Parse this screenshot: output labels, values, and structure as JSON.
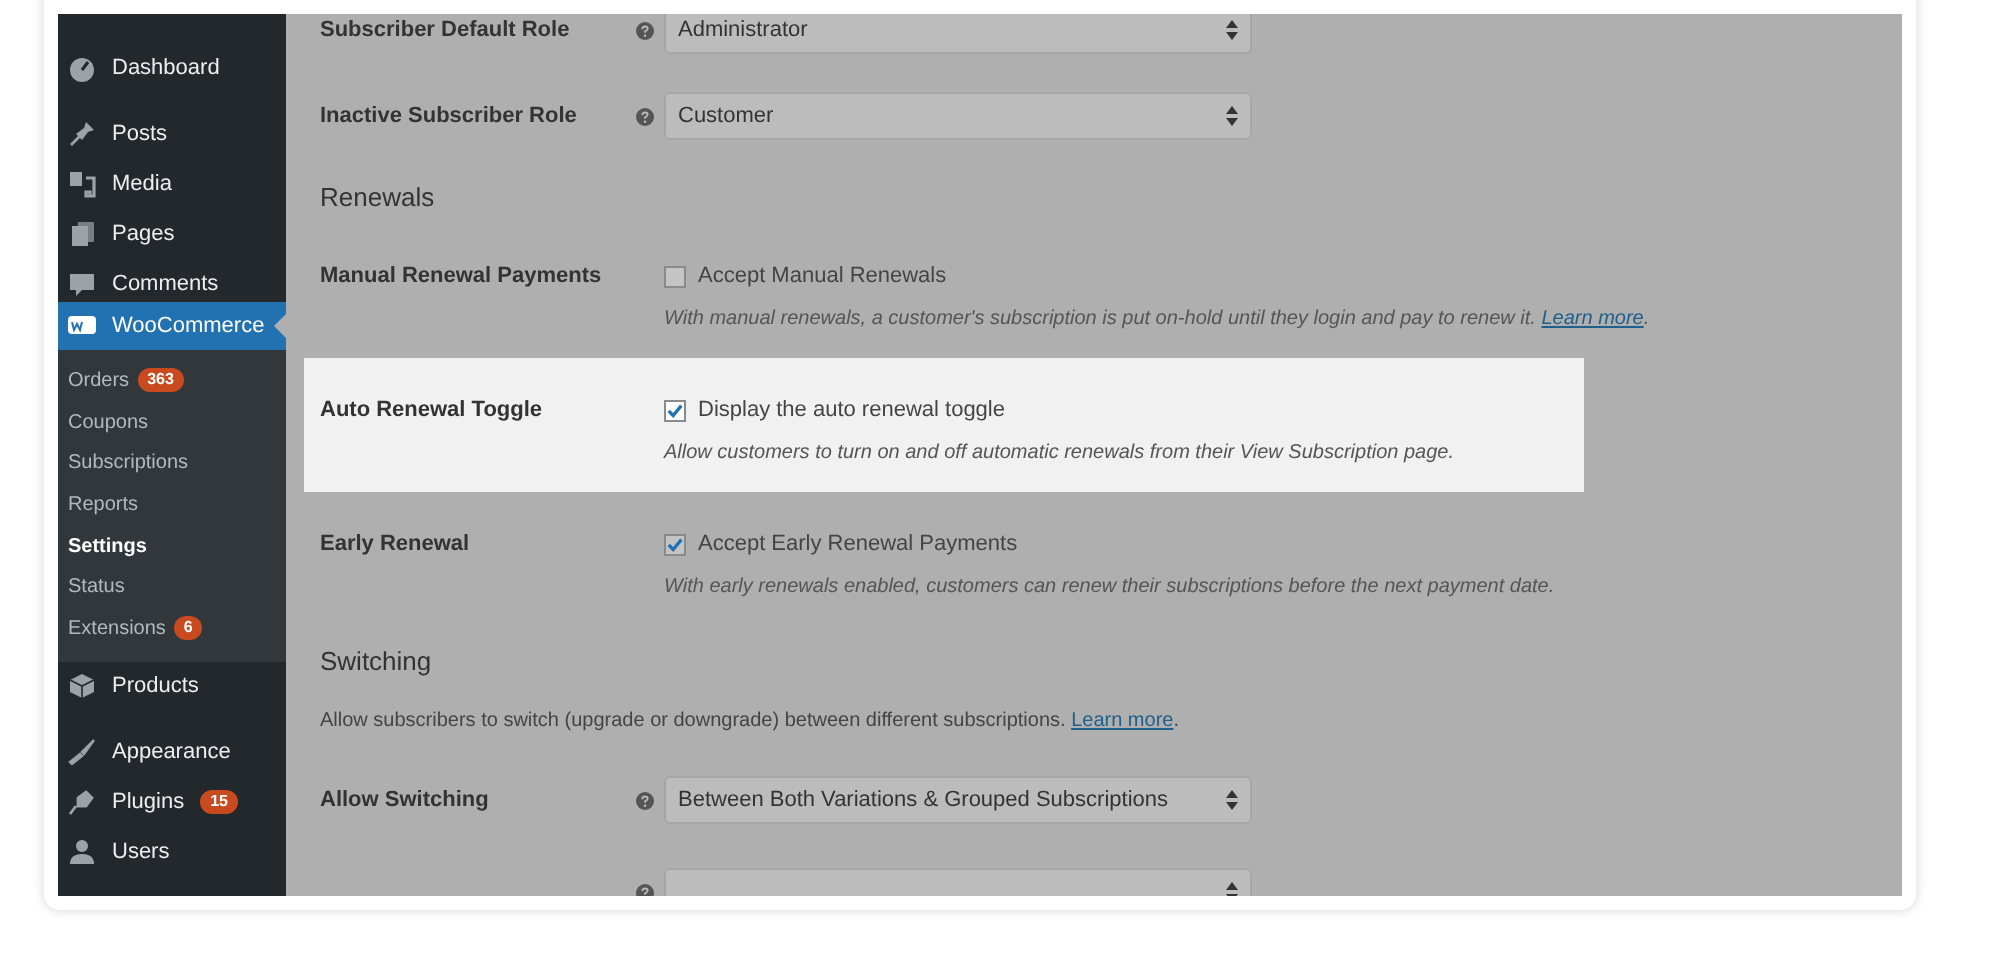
{
  "sidebar": {
    "groups": [
      [
        {
          "label": "Dashboard",
          "selected": false
        }
      ],
      [
        {
          "label": "Posts",
          "selected": false
        },
        {
          "label": "Media",
          "selected": false
        },
        {
          "label": "Pages",
          "selected": false
        },
        {
          "label": "Comments",
          "selected": false
        },
        {
          "label": "WooCommerce",
          "selected": true,
          "children": [
            {
              "label": "Orders",
              "badge": "363",
              "selected": false
            },
            {
              "label": "Coupons",
              "selected": false
            },
            {
              "label": "Subscriptions",
              "selected": false
            },
            {
              "label": "Reports",
              "selected": false
            },
            {
              "label": "Settings",
              "selected": true
            },
            {
              "label": "Status",
              "selected": false
            },
            {
              "label": "Extensions",
              "badge": "6",
              "selected": false
            }
          ]
        },
        {
          "label": "Products",
          "selected": false
        }
      ],
      [
        {
          "label": "Appearance",
          "selected": false
        },
        {
          "label": "Plugins",
          "badge": "15",
          "selected": false
        },
        {
          "label": "Users",
          "selected": false
        }
      ]
    ]
  },
  "settings": [
    {
      "kind": "select",
      "label": "Subscriber Default Role",
      "help": true,
      "value": "Administrator",
      "highlighted": false
    },
    {
      "kind": "select",
      "label": "Inactive Subscriber Role",
      "help": true,
      "value": "Customer",
      "highlighted": false
    },
    {
      "kind": "heading",
      "label": "Renewals"
    },
    {
      "kind": "checkbox",
      "label": "Manual Renewal Payments",
      "option": "Accept Manual Renewals",
      "checked": false,
      "description": "With manual renewals, a customer's subscription is put on-hold until they login and pay to renew it.",
      "link": "Learn more",
      "after_link": ".",
      "highlighted": false
    },
    {
      "kind": "checkbox",
      "label": "Auto Renewal Toggle",
      "option": "Display the auto renewal toggle",
      "checked": true,
      "description": "Allow customers to turn on and off automatic renewals from their View Subscription page.",
      "highlighted": true
    },
    {
      "kind": "checkbox",
      "label": "Early Renewal",
      "option": "Accept Early Renewal Payments",
      "checked": true,
      "description": "With early renewals enabled, customers can renew their subscriptions before the next payment date.",
      "highlighted": false
    },
    {
      "kind": "heading",
      "label": "Switching"
    },
    {
      "kind": "note",
      "text": "Allow subscribers to switch (upgrade or downgrade) between different subscriptions.",
      "link": "Learn more",
      "after_link": "."
    },
    {
      "kind": "select",
      "label": "Allow Switching",
      "help": true,
      "value": "Between Both Variations & Grouped Subscriptions",
      "highlighted": false
    },
    {
      "kind": "select",
      "help": true,
      "highlighted": false
    }
  ]
}
